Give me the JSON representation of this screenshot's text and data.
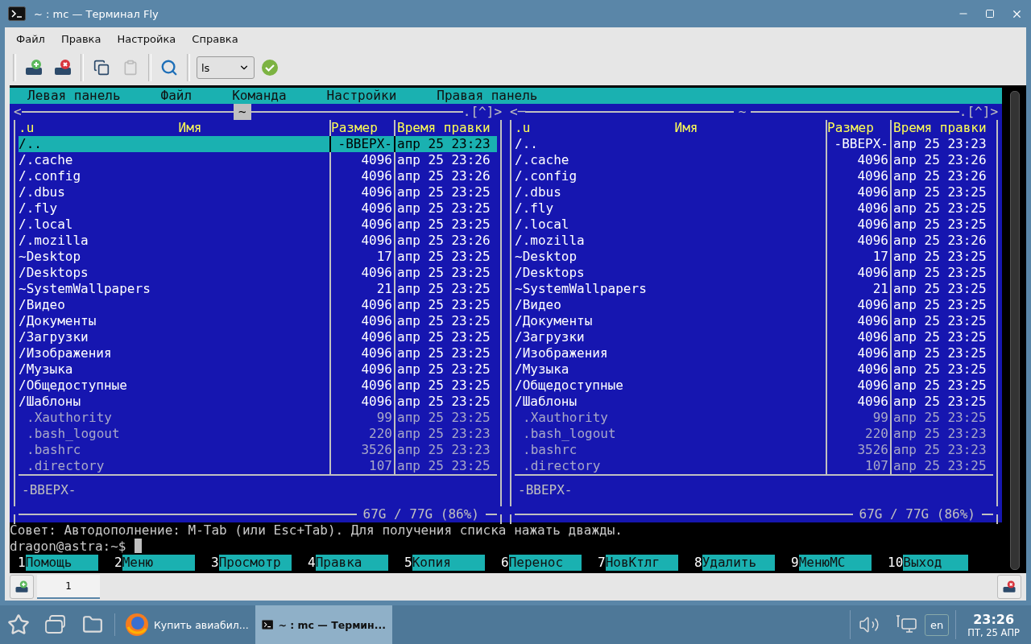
{
  "window": {
    "title": "~ : mc — Терминал Fly"
  },
  "menubar": [
    "Файл",
    "Правка",
    "Настройка",
    "Справка"
  ],
  "toolbar": {
    "command": "ls"
  },
  "mc": {
    "top_menu": [
      "Левая панель",
      "Файл",
      "Команда",
      "Настройки",
      "Правая панель"
    ],
    "panels": [
      {
        "active": true,
        "nav_left": "<",
        "path": "~",
        "nav_right": ".[^]>",
        "sort_mark": ".u",
        "columns": [
          "Имя",
          "Размер",
          "Время правки"
        ],
        "status": "-ВВЕРХ-",
        "disk": "67G / 77G (86%)",
        "rows": [
          {
            "name": "/..",
            "size": "-ВВЕРХ-",
            "time": "апр 25 23:23",
            "kind": "dir",
            "selected": true
          },
          {
            "name": "/.cache",
            "size": "4096",
            "time": "апр 25 23:26",
            "kind": "dir",
            "selected": false
          },
          {
            "name": "/.config",
            "size": "4096",
            "time": "апр 25 23:26",
            "kind": "dir",
            "selected": false
          },
          {
            "name": "/.dbus",
            "size": "4096",
            "time": "апр 25 23:25",
            "kind": "dir",
            "selected": false
          },
          {
            "name": "/.fly",
            "size": "4096",
            "time": "апр 25 23:25",
            "kind": "dir",
            "selected": false
          },
          {
            "name": "/.local",
            "size": "4096",
            "time": "апр 25 23:25",
            "kind": "dir",
            "selected": false
          },
          {
            "name": "/.mozilla",
            "size": "4096",
            "time": "апр 25 23:26",
            "kind": "dir",
            "selected": false
          },
          {
            "name": "~Desktop",
            "size": "17",
            "time": "апр 25 23:25",
            "kind": "link",
            "selected": false
          },
          {
            "name": "/Desktops",
            "size": "4096",
            "time": "апр 25 23:25",
            "kind": "dir",
            "selected": false
          },
          {
            "name": "~SystemWallpapers",
            "size": "21",
            "time": "апр 25 23:25",
            "kind": "link",
            "selected": false
          },
          {
            "name": "/Видео",
            "size": "4096",
            "time": "апр 25 23:25",
            "kind": "dir",
            "selected": false
          },
          {
            "name": "/Документы",
            "size": "4096",
            "time": "апр 25 23:25",
            "kind": "dir",
            "selected": false
          },
          {
            "name": "/Загрузки",
            "size": "4096",
            "time": "апр 25 23:25",
            "kind": "dir",
            "selected": false
          },
          {
            "name": "/Изображения",
            "size": "4096",
            "time": "апр 25 23:25",
            "kind": "dir",
            "selected": false
          },
          {
            "name": "/Музыка",
            "size": "4096",
            "time": "апр 25 23:25",
            "kind": "dir",
            "selected": false
          },
          {
            "name": "/Общедоступные",
            "size": "4096",
            "time": "апр 25 23:25",
            "kind": "dir",
            "selected": false
          },
          {
            "name": "/Шаблоны",
            "size": "4096",
            "time": "апр 25 23:25",
            "kind": "dir",
            "selected": false
          },
          {
            "name": ".Xauthority",
            "size": "99",
            "time": "апр 25 23:25",
            "kind": "file",
            "selected": false
          },
          {
            "name": ".bash_logout",
            "size": "220",
            "time": "апр 25 23:23",
            "kind": "file",
            "selected": false
          },
          {
            "name": ".bashrc",
            "size": "3526",
            "time": "апр 25 23:23",
            "kind": "file",
            "selected": false
          },
          {
            "name": ".directory",
            "size": "107",
            "time": "апр 25 23:25",
            "kind": "file",
            "selected": false
          }
        ]
      },
      {
        "active": false,
        "nav_left": "<─",
        "path": "~",
        "nav_right": ".[^]>",
        "sort_mark": ".u",
        "columns": [
          "Имя",
          "Размер",
          "Время правки"
        ],
        "status": "-ВВЕРХ-",
        "disk": "67G / 77G (86%)",
        "rows": [
          {
            "name": "/..",
            "size": "-ВВЕРХ-",
            "time": "апр 25 23:23",
            "kind": "dir",
            "selected": false
          },
          {
            "name": "/.cache",
            "size": "4096",
            "time": "апр 25 23:26",
            "kind": "dir",
            "selected": false
          },
          {
            "name": "/.config",
            "size": "4096",
            "time": "апр 25 23:26",
            "kind": "dir",
            "selected": false
          },
          {
            "name": "/.dbus",
            "size": "4096",
            "time": "апр 25 23:25",
            "kind": "dir",
            "selected": false
          },
          {
            "name": "/.fly",
            "size": "4096",
            "time": "апр 25 23:25",
            "kind": "dir",
            "selected": false
          },
          {
            "name": "/.local",
            "size": "4096",
            "time": "апр 25 23:25",
            "kind": "dir",
            "selected": false
          },
          {
            "name": "/.mozilla",
            "size": "4096",
            "time": "апр 25 23:26",
            "kind": "dir",
            "selected": false
          },
          {
            "name": "~Desktop",
            "size": "17",
            "time": "апр 25 23:25",
            "kind": "link",
            "selected": false
          },
          {
            "name": "/Desktops",
            "size": "4096",
            "time": "апр 25 23:25",
            "kind": "dir",
            "selected": false
          },
          {
            "name": "~SystemWallpapers",
            "size": "21",
            "time": "апр 25 23:25",
            "kind": "link",
            "selected": false
          },
          {
            "name": "/Видео",
            "size": "4096",
            "time": "апр 25 23:25",
            "kind": "dir",
            "selected": false
          },
          {
            "name": "/Документы",
            "size": "4096",
            "time": "апр 25 23:25",
            "kind": "dir",
            "selected": false
          },
          {
            "name": "/Загрузки",
            "size": "4096",
            "time": "апр 25 23:25",
            "kind": "dir",
            "selected": false
          },
          {
            "name": "/Изображения",
            "size": "4096",
            "time": "апр 25 23:25",
            "kind": "dir",
            "selected": false
          },
          {
            "name": "/Музыка",
            "size": "4096",
            "time": "апр 25 23:25",
            "kind": "dir",
            "selected": false
          },
          {
            "name": "/Общедоступные",
            "size": "4096",
            "time": "апр 25 23:25",
            "kind": "dir",
            "selected": false
          },
          {
            "name": "/Шаблоны",
            "size": "4096",
            "time": "апр 25 23:25",
            "kind": "dir",
            "selected": false
          },
          {
            "name": ".Xauthority",
            "size": "99",
            "time": "апр 25 23:25",
            "kind": "file",
            "selected": false
          },
          {
            "name": ".bash_logout",
            "size": "220",
            "time": "апр 25 23:23",
            "kind": "file",
            "selected": false
          },
          {
            "name": ".bashrc",
            "size": "3526",
            "time": "апр 25 23:23",
            "kind": "file",
            "selected": false
          },
          {
            "name": ".directory",
            "size": "107",
            "time": "апр 25 23:25",
            "kind": "file",
            "selected": false
          }
        ]
      }
    ],
    "hint": "Совет: Автодополнение: M-Tab (или Esc+Tab). Для получения списка нажать дважды.",
    "prompt": "dragon@astra:~$",
    "function_keys": [
      {
        "key": "1",
        "label": "Помощь"
      },
      {
        "key": "2",
        "label": "Меню"
      },
      {
        "key": "3",
        "label": "Просмотр"
      },
      {
        "key": "4",
        "label": "Правка"
      },
      {
        "key": "5",
        "label": "Копия"
      },
      {
        "key": "6",
        "label": "Перенос"
      },
      {
        "key": "7",
        "label": "НовКтлг"
      },
      {
        "key": "8",
        "label": "Удалить"
      },
      {
        "key": "9",
        "label": "МенюMC"
      },
      {
        "key": "10",
        "label": "Выход"
      }
    ]
  },
  "tabs": [
    {
      "label": "1",
      "selected": true
    }
  ],
  "taskbar": {
    "tasks": [
      {
        "label": "Купить авиабил...",
        "kind": "browser",
        "selected": false
      },
      {
        "label": "~ : mc — Термин...",
        "kind": "terminal",
        "selected": true
      }
    ],
    "language": "en",
    "time": "23:26",
    "date": "ПТ, 25 АПР"
  }
}
